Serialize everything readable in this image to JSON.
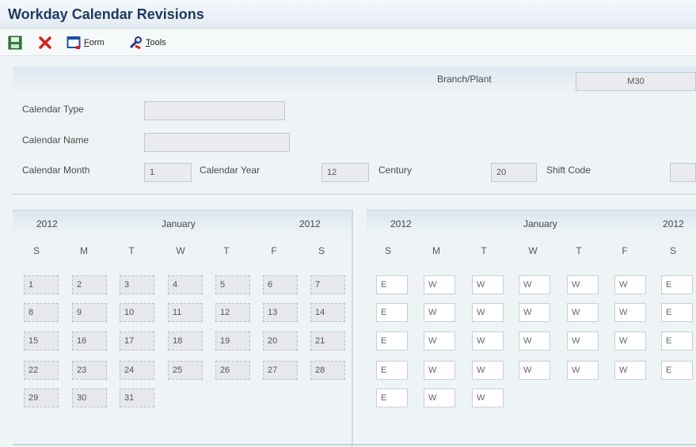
{
  "window": {
    "title": "Workday Calendar Revisions"
  },
  "toolbar": {
    "save_icon": "save-icon",
    "cancel_icon": "close-icon",
    "form_label": "Form",
    "tools_label": "Tools"
  },
  "header": {
    "branch_plant_label": "Branch/Plant",
    "branch_plant_value": "M30"
  },
  "form": {
    "calendar_type_label": "Calendar Type",
    "calendar_type_value": "",
    "calendar_name_label": "Calendar Name",
    "calendar_name_value": "",
    "calendar_month_label": "Calendar Month",
    "calendar_month_value": "1",
    "calendar_year_label": "Calendar Year",
    "calendar_year_value": "12",
    "century_label": "Century",
    "century_value": "20",
    "shift_code_label": "Shift Code",
    "shift_code_value": ""
  },
  "left_calendar": {
    "year_left": "2012",
    "month": "January",
    "year_right": "2012",
    "weekdays": [
      "S",
      "M",
      "T",
      "W",
      "T",
      "F",
      "S"
    ],
    "days": [
      [
        "1",
        "2",
        "3",
        "4",
        "5",
        "6",
        "7"
      ],
      [
        "8",
        "9",
        "10",
        "11",
        "12",
        "13",
        "14"
      ],
      [
        "15",
        "16",
        "17",
        "18",
        "19",
        "20",
        "21"
      ],
      [
        "22",
        "23",
        "24",
        "25",
        "26",
        "27",
        "28"
      ],
      [
        "29",
        "30",
        "31"
      ]
    ]
  },
  "right_calendar": {
    "year_left": "2012",
    "month": "January",
    "year_right": "2012",
    "weekdays": [
      "S",
      "M",
      "T",
      "W",
      "T",
      "F",
      "S"
    ],
    "codes": [
      [
        "E",
        "W",
        "W",
        "W",
        "W",
        "W",
        "E"
      ],
      [
        "E",
        "W",
        "W",
        "W",
        "W",
        "W",
        "E"
      ],
      [
        "E",
        "W",
        "W",
        "W",
        "W",
        "W",
        "E"
      ],
      [
        "E",
        "W",
        "W",
        "W",
        "W",
        "W",
        "E"
      ],
      [
        "E",
        "W",
        "W"
      ]
    ]
  }
}
